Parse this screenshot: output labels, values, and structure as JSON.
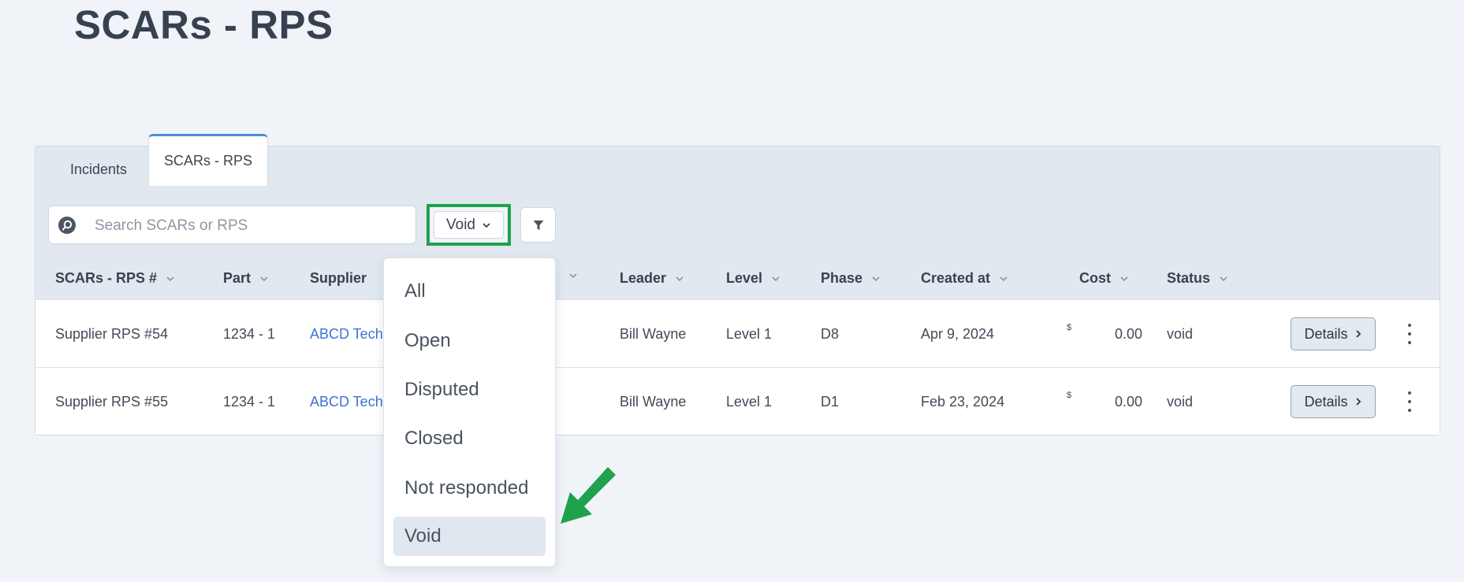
{
  "page": {
    "title": "SCARs - RPS"
  },
  "tabs": [
    {
      "label": "Incidents",
      "active": false
    },
    {
      "label": "SCARs - RPS",
      "active": true
    }
  ],
  "search": {
    "placeholder": "Search SCARs or RPS",
    "value": ""
  },
  "status_filter": {
    "selected": "Void",
    "highlight_color": "#1fa24b"
  },
  "columns": [
    "SCARs - RPS #",
    "Part",
    "Supplier",
    "",
    "Leader",
    "Level",
    "Phase",
    "Created at",
    "Cost",
    "Status"
  ],
  "rows": [
    {
      "id": "Supplier RPS #54",
      "part": "1234 - 1",
      "supplier": "ABCD Tech",
      "leader": "Bill Wayne",
      "level": "Level 1",
      "phase": "D8",
      "created_at": "Apr 9, 2024",
      "currency": "$",
      "cost": "0.00",
      "status": "void",
      "action": "Details"
    },
    {
      "id": "Supplier RPS #55",
      "part": "1234 - 1",
      "supplier": "ABCD Tech",
      "leader": "Bill Wayne",
      "level": "Level 1",
      "phase": "D1",
      "created_at": "Feb 23, 2024",
      "currency": "$",
      "cost": "0.00",
      "status": "void",
      "action": "Details"
    }
  ],
  "dropdown": {
    "options": [
      "All",
      "Open",
      "Disputed",
      "Closed",
      "Not responded",
      "Void"
    ],
    "selected_index": 5
  },
  "annotation": {
    "color": "#1fa24b",
    "icon": "arrow-down-left-icon"
  },
  "colors": {
    "accent": "#4a8fd9",
    "link": "#3c73d6",
    "background": "#f0f4f9"
  }
}
